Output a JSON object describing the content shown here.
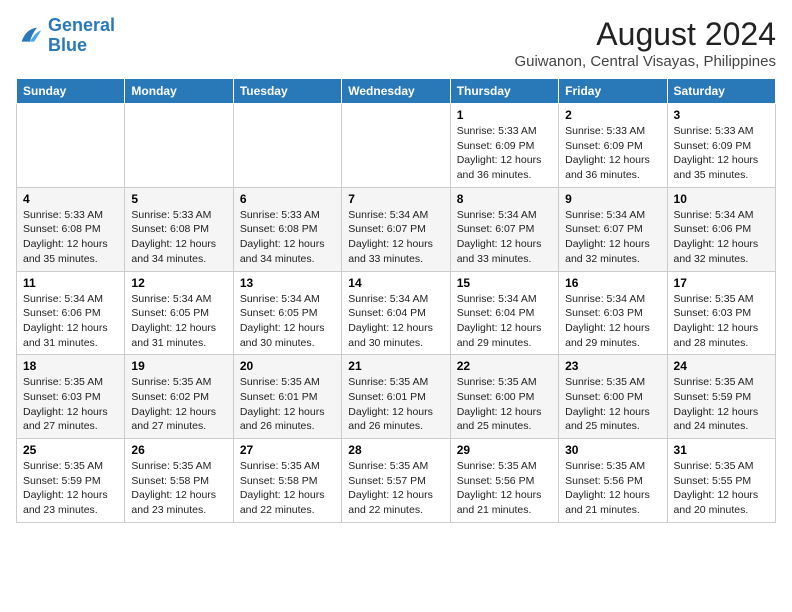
{
  "logo": {
    "line1": "General",
    "line2": "Blue"
  },
  "title": "August 2024",
  "subtitle": "Guiwanon, Central Visayas, Philippines",
  "days_of_week": [
    "Sunday",
    "Monday",
    "Tuesday",
    "Wednesday",
    "Thursday",
    "Friday",
    "Saturday"
  ],
  "weeks": [
    [
      {
        "num": "",
        "info": ""
      },
      {
        "num": "",
        "info": ""
      },
      {
        "num": "",
        "info": ""
      },
      {
        "num": "",
        "info": ""
      },
      {
        "num": "1",
        "info": "Sunrise: 5:33 AM\nSunset: 6:09 PM\nDaylight: 12 hours\nand 36 minutes."
      },
      {
        "num": "2",
        "info": "Sunrise: 5:33 AM\nSunset: 6:09 PM\nDaylight: 12 hours\nand 36 minutes."
      },
      {
        "num": "3",
        "info": "Sunrise: 5:33 AM\nSunset: 6:09 PM\nDaylight: 12 hours\nand 35 minutes."
      }
    ],
    [
      {
        "num": "4",
        "info": "Sunrise: 5:33 AM\nSunset: 6:08 PM\nDaylight: 12 hours\nand 35 minutes."
      },
      {
        "num": "5",
        "info": "Sunrise: 5:33 AM\nSunset: 6:08 PM\nDaylight: 12 hours\nand 34 minutes."
      },
      {
        "num": "6",
        "info": "Sunrise: 5:33 AM\nSunset: 6:08 PM\nDaylight: 12 hours\nand 34 minutes."
      },
      {
        "num": "7",
        "info": "Sunrise: 5:34 AM\nSunset: 6:07 PM\nDaylight: 12 hours\nand 33 minutes."
      },
      {
        "num": "8",
        "info": "Sunrise: 5:34 AM\nSunset: 6:07 PM\nDaylight: 12 hours\nand 33 minutes."
      },
      {
        "num": "9",
        "info": "Sunrise: 5:34 AM\nSunset: 6:07 PM\nDaylight: 12 hours\nand 32 minutes."
      },
      {
        "num": "10",
        "info": "Sunrise: 5:34 AM\nSunset: 6:06 PM\nDaylight: 12 hours\nand 32 minutes."
      }
    ],
    [
      {
        "num": "11",
        "info": "Sunrise: 5:34 AM\nSunset: 6:06 PM\nDaylight: 12 hours\nand 31 minutes."
      },
      {
        "num": "12",
        "info": "Sunrise: 5:34 AM\nSunset: 6:05 PM\nDaylight: 12 hours\nand 31 minutes."
      },
      {
        "num": "13",
        "info": "Sunrise: 5:34 AM\nSunset: 6:05 PM\nDaylight: 12 hours\nand 30 minutes."
      },
      {
        "num": "14",
        "info": "Sunrise: 5:34 AM\nSunset: 6:04 PM\nDaylight: 12 hours\nand 30 minutes."
      },
      {
        "num": "15",
        "info": "Sunrise: 5:34 AM\nSunset: 6:04 PM\nDaylight: 12 hours\nand 29 minutes."
      },
      {
        "num": "16",
        "info": "Sunrise: 5:34 AM\nSunset: 6:03 PM\nDaylight: 12 hours\nand 29 minutes."
      },
      {
        "num": "17",
        "info": "Sunrise: 5:35 AM\nSunset: 6:03 PM\nDaylight: 12 hours\nand 28 minutes."
      }
    ],
    [
      {
        "num": "18",
        "info": "Sunrise: 5:35 AM\nSunset: 6:03 PM\nDaylight: 12 hours\nand 27 minutes."
      },
      {
        "num": "19",
        "info": "Sunrise: 5:35 AM\nSunset: 6:02 PM\nDaylight: 12 hours\nand 27 minutes."
      },
      {
        "num": "20",
        "info": "Sunrise: 5:35 AM\nSunset: 6:01 PM\nDaylight: 12 hours\nand 26 minutes."
      },
      {
        "num": "21",
        "info": "Sunrise: 5:35 AM\nSunset: 6:01 PM\nDaylight: 12 hours\nand 26 minutes."
      },
      {
        "num": "22",
        "info": "Sunrise: 5:35 AM\nSunset: 6:00 PM\nDaylight: 12 hours\nand 25 minutes."
      },
      {
        "num": "23",
        "info": "Sunrise: 5:35 AM\nSunset: 6:00 PM\nDaylight: 12 hours\nand 25 minutes."
      },
      {
        "num": "24",
        "info": "Sunrise: 5:35 AM\nSunset: 5:59 PM\nDaylight: 12 hours\nand 24 minutes."
      }
    ],
    [
      {
        "num": "25",
        "info": "Sunrise: 5:35 AM\nSunset: 5:59 PM\nDaylight: 12 hours\nand 23 minutes."
      },
      {
        "num": "26",
        "info": "Sunrise: 5:35 AM\nSunset: 5:58 PM\nDaylight: 12 hours\nand 23 minutes."
      },
      {
        "num": "27",
        "info": "Sunrise: 5:35 AM\nSunset: 5:58 PM\nDaylight: 12 hours\nand 22 minutes."
      },
      {
        "num": "28",
        "info": "Sunrise: 5:35 AM\nSunset: 5:57 PM\nDaylight: 12 hours\nand 22 minutes."
      },
      {
        "num": "29",
        "info": "Sunrise: 5:35 AM\nSunset: 5:56 PM\nDaylight: 12 hours\nand 21 minutes."
      },
      {
        "num": "30",
        "info": "Sunrise: 5:35 AM\nSunset: 5:56 PM\nDaylight: 12 hours\nand 21 minutes."
      },
      {
        "num": "31",
        "info": "Sunrise: 5:35 AM\nSunset: 5:55 PM\nDaylight: 12 hours\nand 20 minutes."
      }
    ]
  ]
}
